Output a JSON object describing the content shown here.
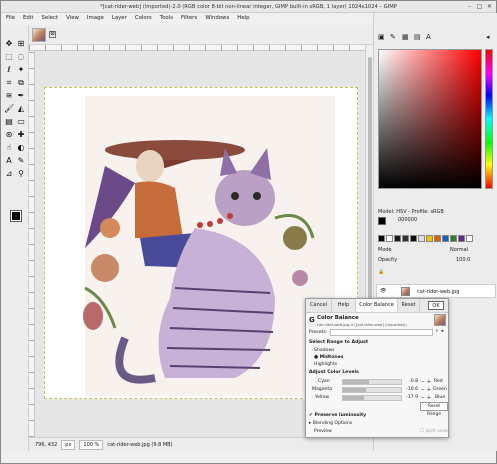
{
  "window": {
    "title": "*[cat-rider-web] (imported)-2.0 (RGB color 8-bit non-linear integer, GIMP built-in sRGB, 1 layer) 1024x1024 – GIMP",
    "controls": [
      "–",
      "□",
      "✕"
    ]
  },
  "menu": [
    "File",
    "Edit",
    "Select",
    "View",
    "Image",
    "Layer",
    "Colors",
    "Tools",
    "Filters",
    "Windows",
    "Help"
  ],
  "image_tab": {
    "close_glyph": "⊠"
  },
  "status": {
    "coords": "796, 432",
    "unit": "px",
    "zoom": "100 %",
    "file": "cat-rider-web.jpg (9.8 MB)"
  },
  "dock": {
    "model_label": "Model: HSV - Profile: sRGB",
    "hex_value": "000000",
    "mode_label": "Mode",
    "mode_value": "Normal",
    "opacity_label": "Opacity",
    "opacity_value": "100.0",
    "layer_name": "cat-rider-web.jpg",
    "swatch_colors": [
      "#000000",
      "#ffffff",
      "#1a1a1a",
      "#333333",
      "#0b0b0b",
      "#e0e0e0",
      "#f2c200",
      "#e06000",
      "#1565c0",
      "#2e7d32",
      "#5c2d91",
      "#ffffff"
    ]
  },
  "dialog": {
    "buttons": [
      "Cancel",
      "Help",
      "Color Balance",
      "Reset",
      "OK"
    ],
    "title": "Color Balance",
    "subtitle": "cat-rider-web.jpg-4 ([cat-rider-web] (imported))",
    "presets_label": "Presets:",
    "range_heading": "Select Range to Adjust",
    "ranges": [
      "Shadows",
      "Midtones",
      "Highlights"
    ],
    "selected_range": "Midtones",
    "levels_heading": "Adjust Color Levels",
    "levels": [
      {
        "left": "Cyan",
        "right": "Red",
        "value": "-0.8"
      },
      {
        "left": "Magenta",
        "right": "Green",
        "value": "-10.6"
      },
      {
        "left": "Yellow",
        "right": "Blue",
        "value": "-17.9"
      }
    ],
    "reset_range": "Reset Range",
    "preserve": "Preserve luminosity",
    "blending": "Blending Options",
    "preview": "Preview",
    "split_view": "Split view"
  }
}
